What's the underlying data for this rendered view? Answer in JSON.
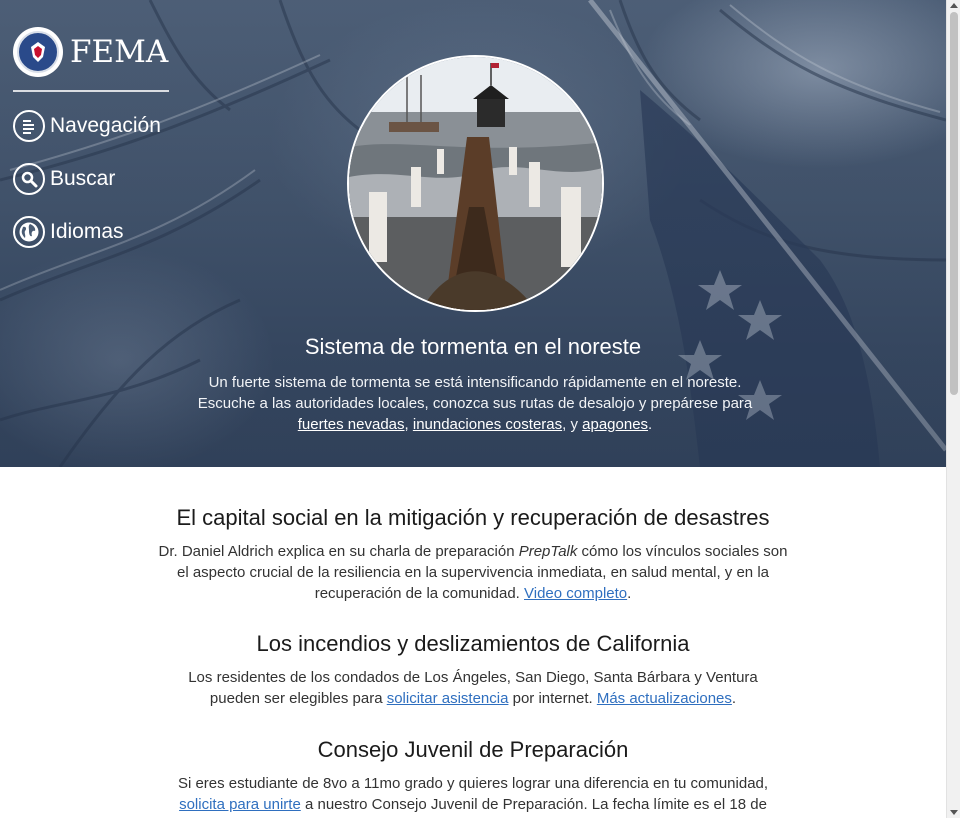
{
  "brand": {
    "name": "FEMA",
    "seal_icon": "dhs-seal-icon"
  },
  "nav": {
    "items": [
      {
        "label": "Navegación",
        "icon": "menu-icon"
      },
      {
        "label": "Buscar",
        "icon": "search-icon"
      },
      {
        "label": "Idiomas",
        "icon": "globe-icon"
      }
    ]
  },
  "hero": {
    "title": "Sistema de tormenta en el noreste",
    "desc_pre": "Un fuerte sistema de tormenta se está intensificando rápidamente en el noreste. Escuche a las autoridades locales, conozca sus rutas de desalojo y prepárese para ",
    "link1": "fuertes nevadas",
    "sep1": ", ",
    "link2": "inundaciones costeras",
    "sep2": ", y ",
    "link3": "apagones",
    "end": "."
  },
  "sections": [
    {
      "title": "El capital social en la mitigación y recuperación de desastres",
      "text_pre": "Dr. Daniel Aldrich explica en su charla de preparación ",
      "italic": "PrepTalk",
      "text_mid": " cómo los vínculos sociales son el aspecto crucial de la resiliencia en la supervivencia inmediata, en salud mental, y en la recuperación de la comunidad. ",
      "link": "Video completo",
      "end": "."
    },
    {
      "title": "Los incendios y deslizamientos de California",
      "text_pre": "Los residentes de los condados de Los Ángeles, San Diego, Santa Bárbara y Ventura pueden ser elegibles para ",
      "link1": "solicitar asistencia",
      "text_mid": " por internet. ",
      "link2": "Más actualizaciones",
      "end": "."
    },
    {
      "title": "Consejo Juvenil de Preparación",
      "text_pre": "Si eres estudiante de 8vo a 11mo grado y quieres lograr una diferencia en tu comunidad, ",
      "link": "solicita para unirte",
      "text_post": " a nuestro Consejo Juvenil de Preparación. La fecha límite es el 18 de"
    }
  ],
  "colors": {
    "link": "#2f6fbf",
    "hero_bg": "#4a5c74"
  }
}
